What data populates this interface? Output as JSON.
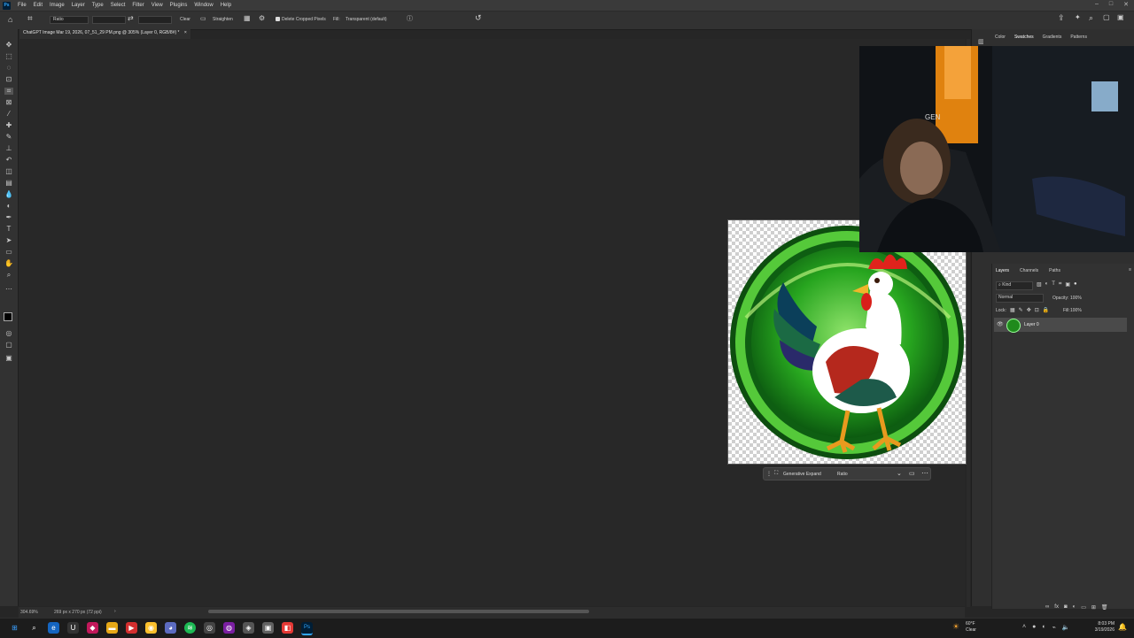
{
  "menu": [
    "File",
    "Edit",
    "Image",
    "Layer",
    "Type",
    "Select",
    "Filter",
    "View",
    "Plugins",
    "Window",
    "Help"
  ],
  "ps_badge": "Ps",
  "options": {
    "ratio_label": "Ratio",
    "clear_label": "Clear",
    "straighten_label": "Straighten",
    "delete_cropped_label": "Delete Cropped Pixels",
    "fill_label": "Fill:",
    "fill_value": "Transparent (default)"
  },
  "document_tab": "ChatGPT Image Mar 19, 2026, 07_51_29 PM.png @ 305% (Layer 0, RGB/8#) *",
  "panel_tabs_top": [
    "Color",
    "Swatches",
    "Gradients",
    "Patterns"
  ],
  "webcam_text": "GEN",
  "layers_panel": {
    "tabs": [
      "Layers",
      "Channels",
      "Paths"
    ],
    "filter_label": "Kind",
    "blend_mode": "Normal",
    "opacity_label": "Opacity:",
    "opacity_value": "100%",
    "lock_label": "Lock:",
    "fill_label": "Fill:",
    "fill_value": "100%",
    "layer_name": "Layer 0"
  },
  "context_bar": {
    "action_label": "Generative Expand",
    "ratio_label": "Ratio"
  },
  "status": {
    "zoom": "304.69%",
    "dimensions": "269 px x 270 px (72 ppi)"
  },
  "taskbar": {
    "weather_temp": "60°F",
    "weather_cond": "Clear",
    "time": "8:03 PM",
    "date": "3/19/2026"
  },
  "colors": {
    "app_bg": "#262626",
    "panel_bg": "#323232",
    "accent_green": "#2ca02c",
    "taskbar_bg": "#1c1c1c"
  }
}
